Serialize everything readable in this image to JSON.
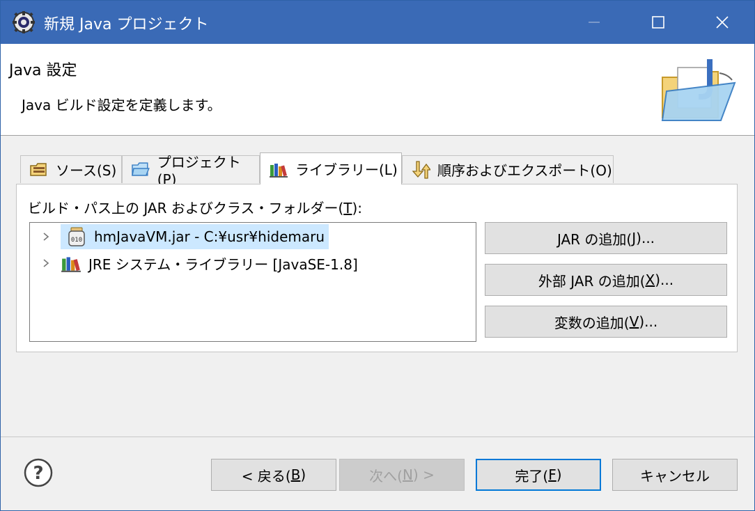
{
  "titlebar": {
    "title": "新規 Java プロジェクト",
    "icons": {
      "app": "eclipse-gear-icon",
      "minimize": "minimize-icon",
      "maximize": "maximize-icon",
      "close": "close-icon"
    }
  },
  "banner": {
    "heading": "Java 設定",
    "description": "Java ビルド設定を定義します。",
    "icon": "java-project-folder-icon"
  },
  "tabs": [
    {
      "label": "ソース(S)",
      "icon": "source-folder-icon",
      "active": false
    },
    {
      "label": "プロジェクト(P)",
      "icon": "project-folder-icon",
      "active": false
    },
    {
      "label": "ライブラリー(L)",
      "icon": "library-icon",
      "active": true
    },
    {
      "label": "順序およびエクスポート(O)",
      "icon": "order-export-icon",
      "active": false
    }
  ],
  "panel": {
    "label_prefix": "ビルド・パス上の JAR およびクラス・フォルダー(",
    "label_mnemonic": "T",
    "label_suffix": "):",
    "tree": [
      {
        "label": "hmJavaVM.jar - C:¥usr¥hidemaru",
        "icon": "jar-file-icon",
        "selected": true
      },
      {
        "label": "JRE システム・ライブラリー [JavaSE-1.8]",
        "icon": "library-icon",
        "selected": false
      }
    ],
    "buttons": [
      {
        "pre": "JAR の追加(",
        "mn": "J",
        "post": ")..."
      },
      {
        "pre": "外部 JAR の追加(",
        "mn": "X",
        "post": ")..."
      },
      {
        "pre": "変数の追加(",
        "mn": "V",
        "post": ")..."
      }
    ]
  },
  "footer": {
    "help_icon": "help-icon",
    "back": {
      "pre": "< 戻る(",
      "mn": "B",
      "post": ")"
    },
    "next": {
      "pre": "次へ(",
      "mn": "N",
      "post": ") >"
    },
    "finish": {
      "pre": "完了(",
      "mn": "F",
      "post": ")"
    },
    "cancel": "キャンセル"
  },
  "colors": {
    "titlebar": "#3a6ab6",
    "selection": "#cce8ff",
    "default_border": "#0078d7"
  }
}
